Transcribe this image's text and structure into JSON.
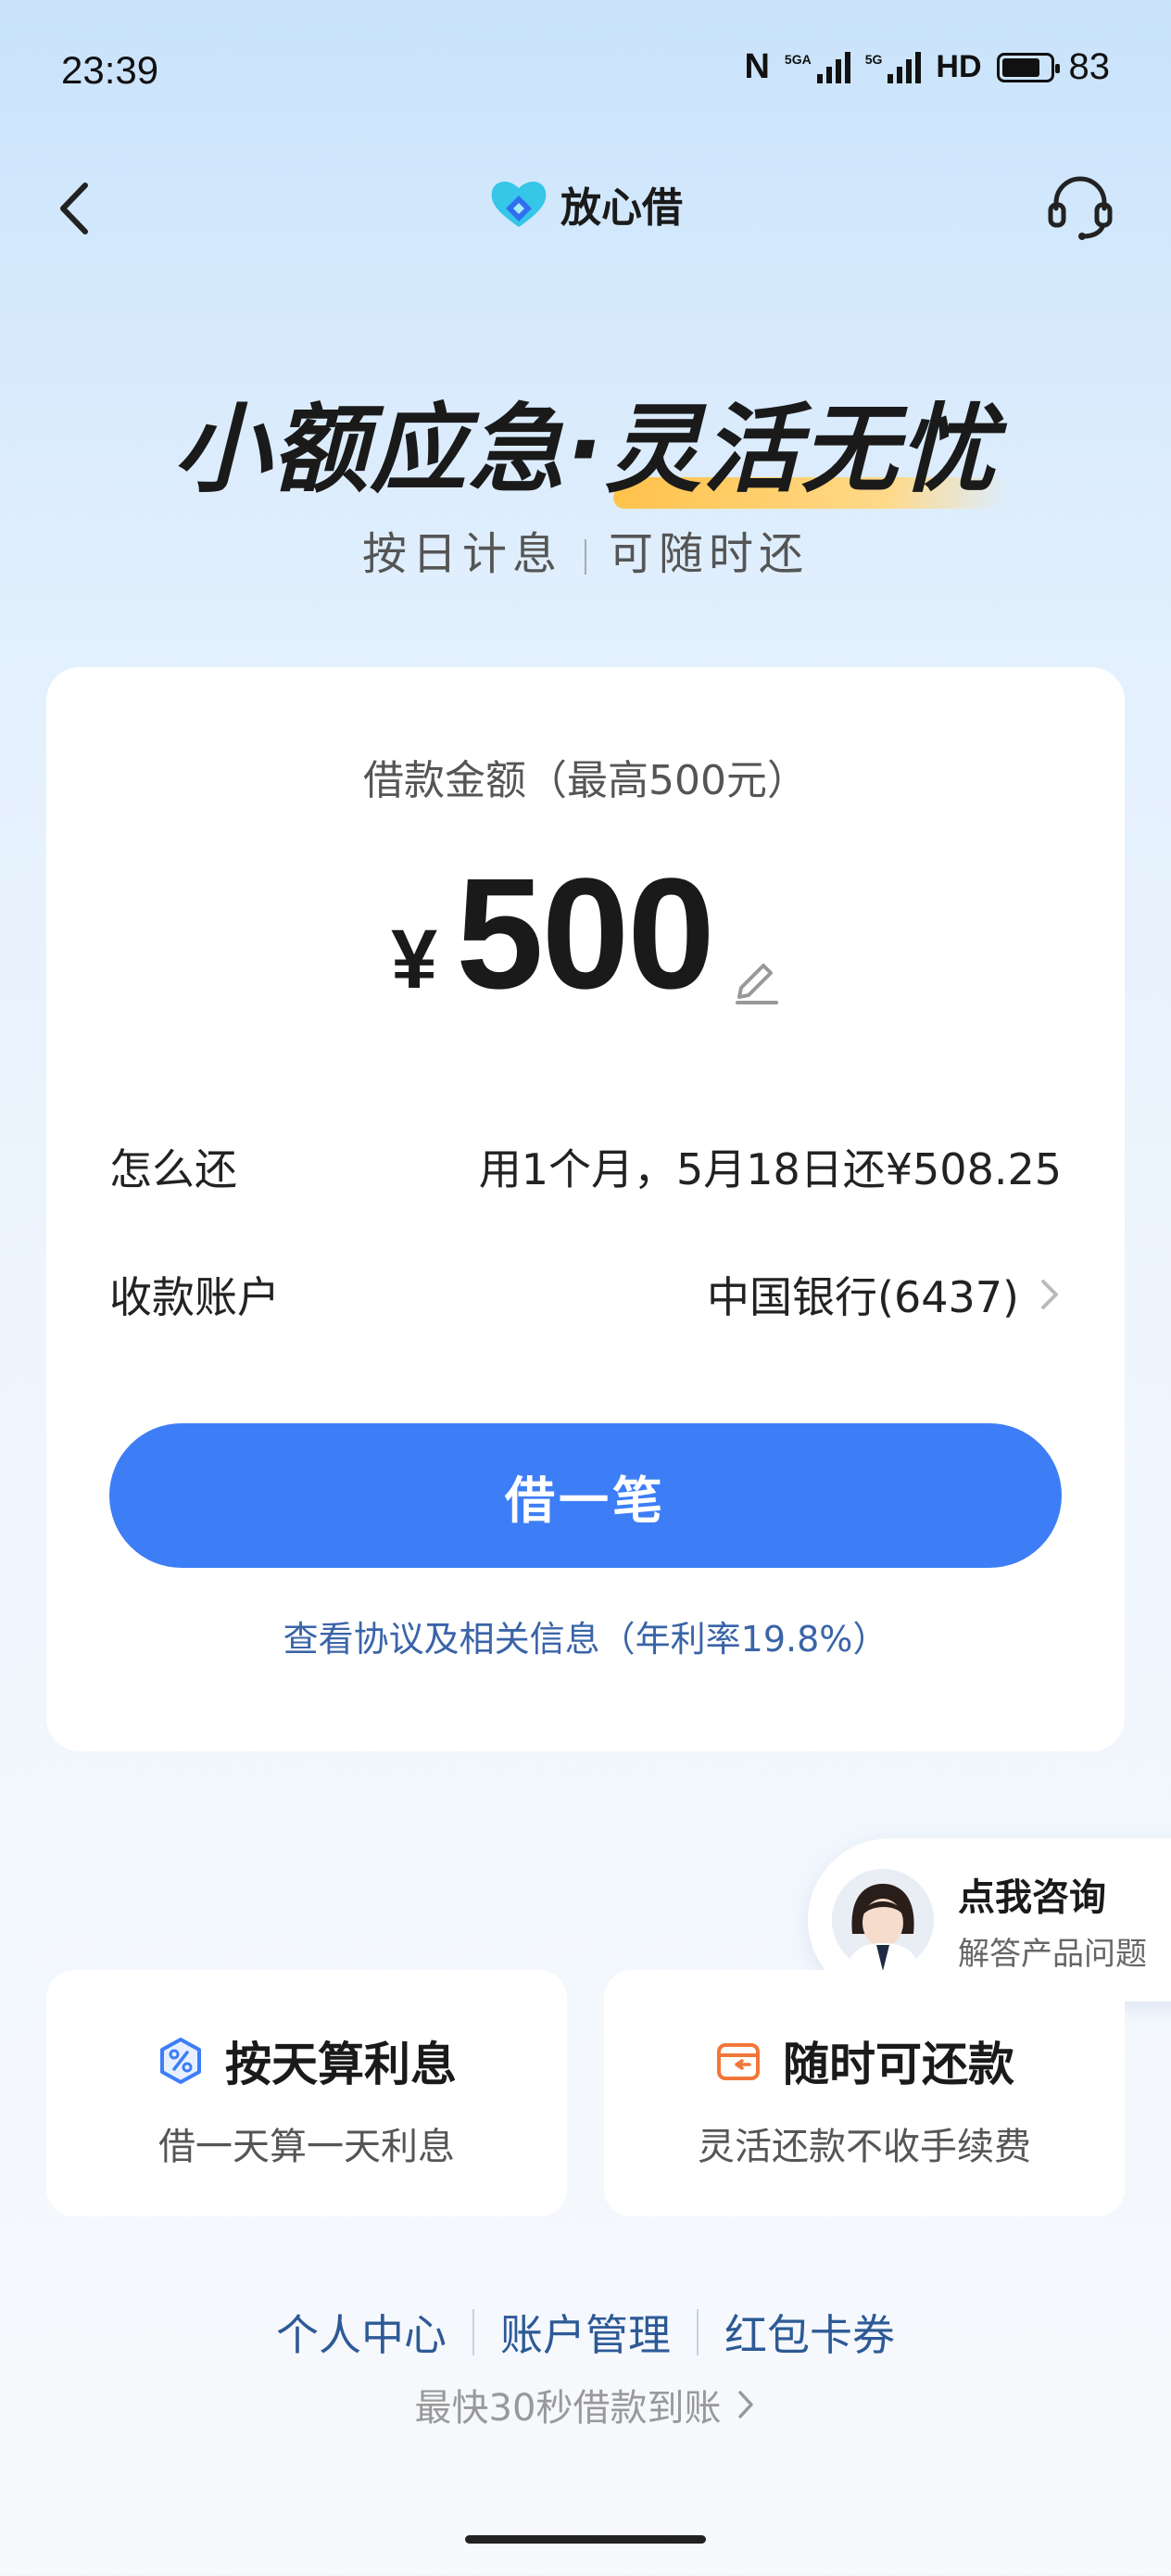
{
  "status_bar": {
    "time": "23:39",
    "network_a": "5GA",
    "network_b": "5G",
    "hd": "HD",
    "battery": "83"
  },
  "nav": {
    "brand": "放心借"
  },
  "hero": {
    "title_a": "小额应急·",
    "title_b": "灵活无忧",
    "sub_a": "按日计息",
    "sub_b": "可随时还"
  },
  "card": {
    "amount_label": "借款金额（最高500元）",
    "currency": "¥",
    "amount": "500",
    "repay_label": "怎么还",
    "repay_value": "用1个月，5月18日还¥508.25",
    "account_label": "收款账户",
    "account_value": "中国银行(6437)",
    "cta": "借一笔",
    "agreement": "查看协议及相关信息（年利率19.8%）"
  },
  "consult": {
    "title": "点我咨询",
    "subtitle": "解答产品问题"
  },
  "features": [
    {
      "title": "按天算利息",
      "subtitle": "借一天算一天利息",
      "icon": "percent-icon",
      "color": "#3d7ef6"
    },
    {
      "title": "随时可还款",
      "subtitle": "灵活还款不收手续费",
      "icon": "wallet-icon",
      "color": "#f0773a"
    }
  ],
  "footer": {
    "links": [
      "个人中心",
      "账户管理",
      "红包卡券"
    ],
    "fast_text": "最快30秒借款到账"
  },
  "colors": {
    "primary": "#3d7ef6",
    "link": "#2d5a96",
    "accent": "#ffc24a"
  }
}
